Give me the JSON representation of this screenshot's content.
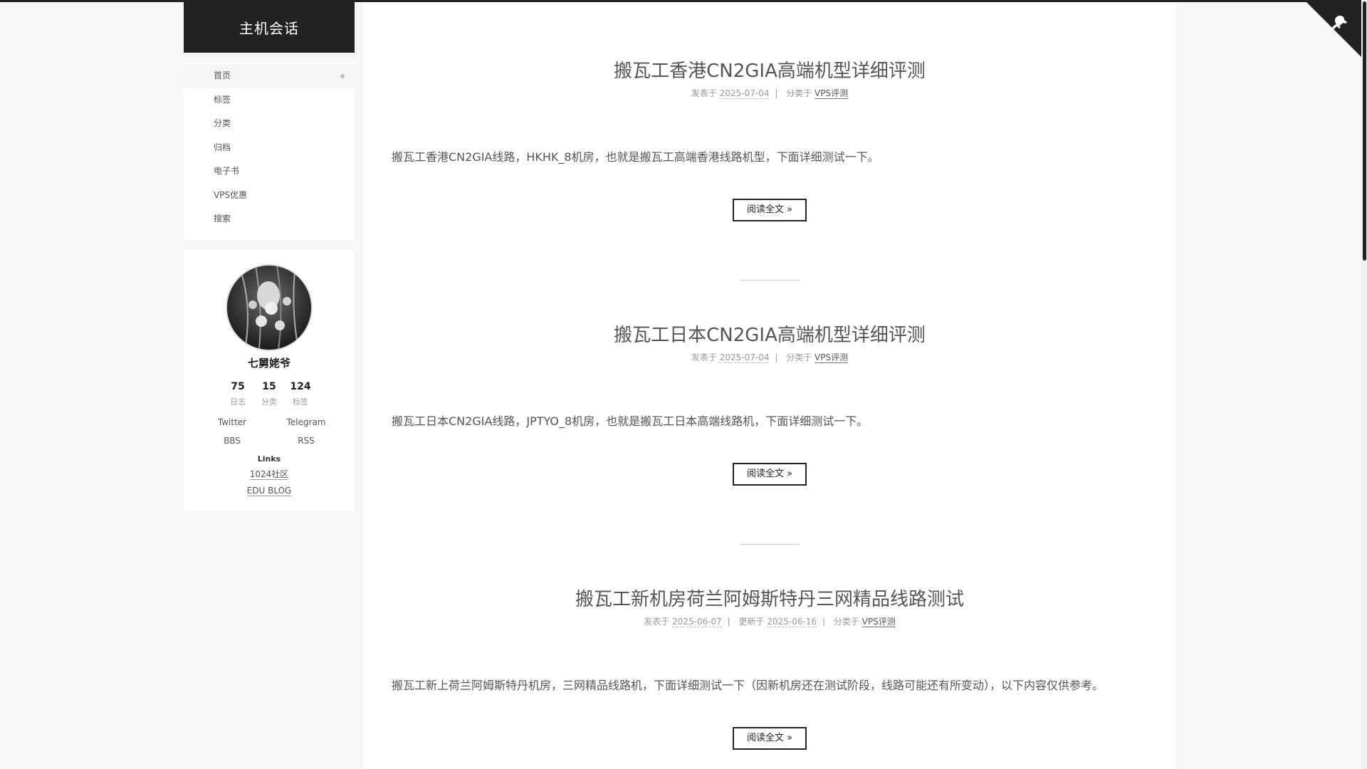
{
  "site": {
    "title": "主机会话"
  },
  "menu": {
    "items": [
      {
        "label": "首页"
      },
      {
        "label": "标签"
      },
      {
        "label": "分类"
      },
      {
        "label": "归档"
      },
      {
        "label": "电子书"
      },
      {
        "label": "VPS优惠"
      },
      {
        "label": "搜索"
      }
    ]
  },
  "profile": {
    "name": "七舅姥爷",
    "stats": [
      {
        "value": "75",
        "label": "日志"
      },
      {
        "value": "15",
        "label": "分类"
      },
      {
        "value": "124",
        "label": "标签"
      }
    ],
    "socials": [
      "Twitter",
      "Telegram",
      "BBS",
      "RSS"
    ],
    "links_title": "Links",
    "links": [
      "1024社区",
      "EDU BLOG"
    ]
  },
  "posts": [
    {
      "title": "搬瓦工香港CN2GIA高端机型详细评测",
      "posted_prefix": "发表于",
      "posted_date": "2025-07-04",
      "sep": "|",
      "category_prefix": "分类于",
      "category": "VPS评测",
      "excerpt": "搬瓦工香港CN2GIA线路，HKHK_8机房，也就是搬瓦工高端香港线路机型，下面详细测试一下。",
      "read_more": "阅读全文 »"
    },
    {
      "title": "搬瓦工日本CN2GIA高端机型详细评测",
      "posted_prefix": "发表于",
      "posted_date": "2025-07-04",
      "sep": "|",
      "category_prefix": "分类于",
      "category": "VPS评测",
      "excerpt": "搬瓦工日本CN2GIA线路，JPTYO_8机房，也就是搬瓦工日本高端线路机，下面详细测试一下。",
      "read_more": "阅读全文 »"
    },
    {
      "title": "搬瓦工新机房荷兰阿姆斯特丹三网精品线路测试",
      "posted_prefix": "发表于",
      "posted_date": "2025-06-07",
      "sep": "|",
      "updated_prefix": "更新于",
      "updated_date": "2025-06-16",
      "sep2": "|",
      "category_prefix": "分类于",
      "category": "VPS评测",
      "excerpt": "搬瓦工新上荷兰阿姆斯特丹机房，三网精品线路机，下面详细测试一下（因新机房还在测试阶段，线路可能还有所变动），以下内容仅供参考。",
      "read_more": "阅读全文 »"
    }
  ],
  "colors": {
    "brand_bg": "#222222",
    "page_bg": "#f5f7f9",
    "text": "#555555",
    "muted": "#999999"
  },
  "icons": {
    "corner": "github-octocat-icon",
    "menu_active": "dot-icon"
  }
}
